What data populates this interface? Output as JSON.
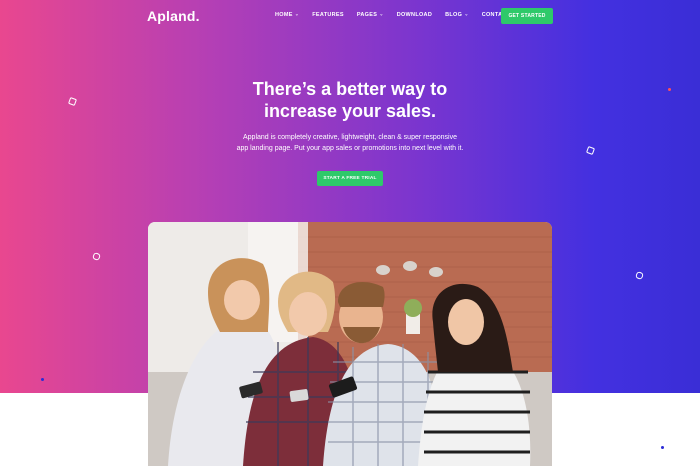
{
  "nav": {
    "logo": "Apland.",
    "items": [
      {
        "label": "HOME",
        "dropdown": true
      },
      {
        "label": "FEATURES",
        "dropdown": false
      },
      {
        "label": "PAGES",
        "dropdown": true
      },
      {
        "label": "DOWNLOAD",
        "dropdown": false
      },
      {
        "label": "BLOG",
        "dropdown": true
      },
      {
        "label": "CONTACT",
        "dropdown": false
      }
    ],
    "cta_label": "GET STARTED"
  },
  "hero": {
    "headline_line1": "There’s a better way to",
    "headline_line2": "increase your sales.",
    "subtext_line1": "Appland is completely creative, lightweight, clean & super responsive",
    "subtext_line2": "app landing page. Put your app sales or promotions into next level with it.",
    "cta_label": "START A FREE TRIAL"
  },
  "colors": {
    "gradient_start": "#e9478f",
    "gradient_end": "#3a2ed6",
    "accent_green": "#2ec96a",
    "background": "#ffffff"
  },
  "image": {
    "semantic": "group-of-friends-looking-at-phones-photo"
  }
}
